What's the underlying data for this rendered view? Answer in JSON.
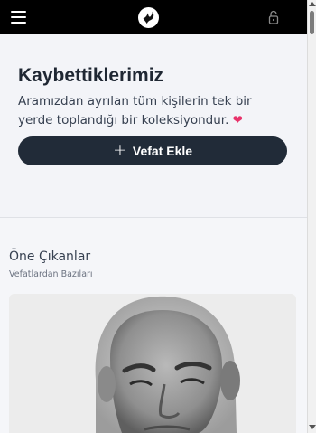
{
  "header": {
    "menu_icon": "hamburger-menu-icon",
    "logo_icon": "dove-icon",
    "lock_icon": "unlock-icon"
  },
  "hero": {
    "title": "Kaybettiklerimiz",
    "description": "Aramızdan ayrılan tüm kişilerin tek bir yerde toplandığı bir koleksiyondur.",
    "heart": "❤",
    "add_button": {
      "icon": "+",
      "label": "Vefat Ekle"
    }
  },
  "featured": {
    "title": "Öne Çıkanlar",
    "subtitle": "Vefatlardan Bazıları"
  },
  "colors": {
    "topbar": "#000000",
    "button": "#212b38",
    "heart": "#e8336b",
    "background": "#f3f4f8"
  }
}
